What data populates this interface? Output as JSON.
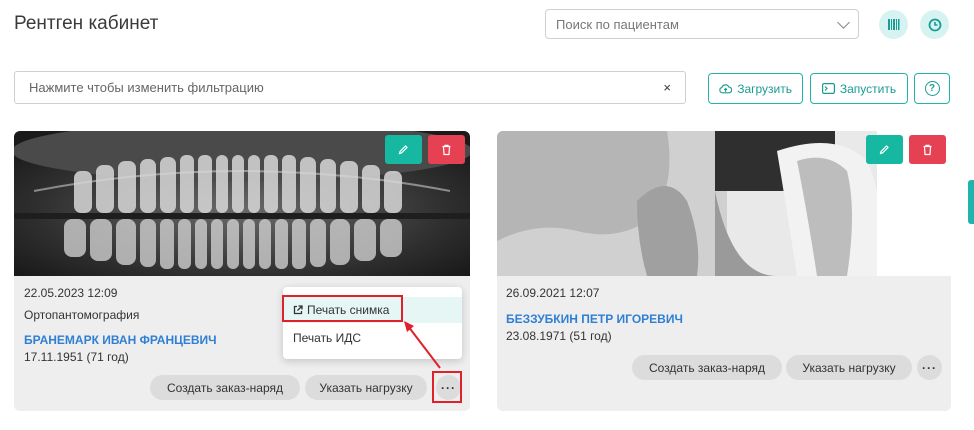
{
  "header": {
    "title": "Рентген кабинет",
    "search_placeholder": "Поиск по пациентам",
    "barcode_icon": "barcode-icon",
    "clock_icon": "clock-icon"
  },
  "filter": {
    "placeholder": "Нажмите чтобы изменить фильтрацию",
    "clear": "×"
  },
  "toolbar": {
    "upload_label": "Загрузить",
    "launch_label": "Запустить",
    "help_label": "?"
  },
  "cards": [
    {
      "date": "22.05.2023 12:09",
      "study_type": "Ортопантомография",
      "patient_name": "БРАНЕМАРК ИВАН ФРАНЦЕВИЧ",
      "birth": "17.11.1951 (71 год)",
      "create_order": "Создать заказ-наряд",
      "set_load": "Указать нагрузку",
      "more": "···"
    },
    {
      "date": "26.09.2021 12:07",
      "study_type": "",
      "patient_name": "БЕЗЗУБКИН ПЕТР ИГОРЕВИЧ",
      "birth": "23.08.1971 (51 год)",
      "create_order": "Создать заказ-наряд",
      "set_load": "Указать нагрузку",
      "more": "···"
    }
  ],
  "context_menu": {
    "items": [
      {
        "label": "Печать снимка",
        "icon": "external-link-icon"
      },
      {
        "label": "Печать ИДС"
      }
    ]
  },
  "colors": {
    "accent": "#1fb5ac",
    "edit": "#17b8a1",
    "delete": "#e64053",
    "name": "#2f7fd4",
    "highlight": "#e0212b"
  }
}
